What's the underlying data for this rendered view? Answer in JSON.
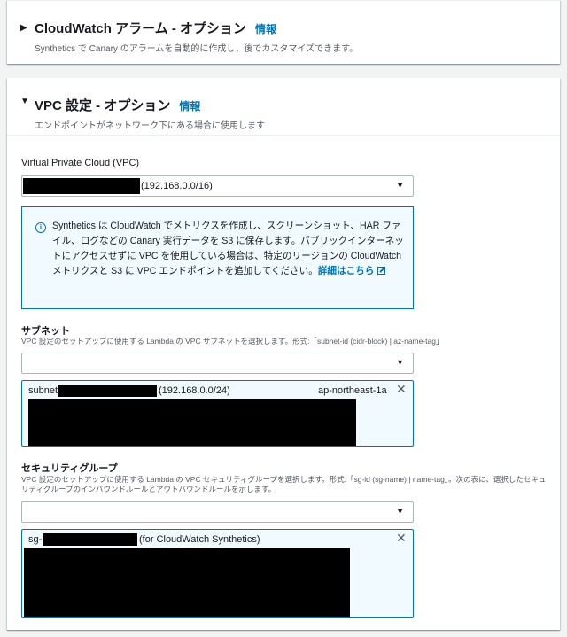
{
  "alarm_panel": {
    "title": "CloudWatch アラーム - オプション",
    "info_link": "情報",
    "description": "Synthetics で Canary のアラームを自動的に作成し、後でカスタマイズできます。"
  },
  "vpc_panel": {
    "title": "VPC 設定 - オプション",
    "info_link": "情報",
    "description": "エンドポイントがネットワーク下にある場合に使用します",
    "vpc_field": {
      "label": "Virtual Private Cloud (VPC)",
      "selected_value": "(192.168.0.0/16)"
    },
    "info_box": {
      "text": "Synthetics は CloudWatch でメトリクスを作成し、スクリーンショット、HAR ファイル、ログなどの Canary 実行データを S3 に保存します。パブリックインターネットにアクセスせずに VPC を使用している場合は、特定のリージョンの CloudWatch メトリクスと S3 に VPC エンドポイントを追加してください。",
      "link": "詳細はこちら"
    },
    "subnet_field": {
      "label": "サブネット",
      "description": "VPC 設定のセットアップに使用する Lambda の VPC サブネットを選択します。形式:「subnet-id (cidr-block) | az-name-tag」",
      "token": {
        "prefix": "subnet",
        "cidr": "(192.168.0.0/24)",
        "az": "ap-northeast-1a"
      }
    },
    "security_group_field": {
      "label": "セキュリティグループ",
      "description": "VPC 設定のセットアップに使用する Lambda の VPC セキュリティグループを選択します。形式:「sg-id (sg-name) | name-tag」。次の表に、選択したセキュリティグループのインバウンドルールとアウトバウンドルールを示します。",
      "token": {
        "prefix": "sg-",
        "name": "(for CloudWatch Synthetics)"
      }
    }
  },
  "icons": {
    "expand": "caret-right-icon",
    "collapse": "caret-down-icon",
    "dropdown": "caret-down-icon",
    "info": "info-circle-icon",
    "external": "external-link-icon",
    "remove": "close-icon"
  },
  "colors": {
    "link": "#0073bb",
    "info_bg": "#f1faff",
    "redaction": "#000000"
  }
}
